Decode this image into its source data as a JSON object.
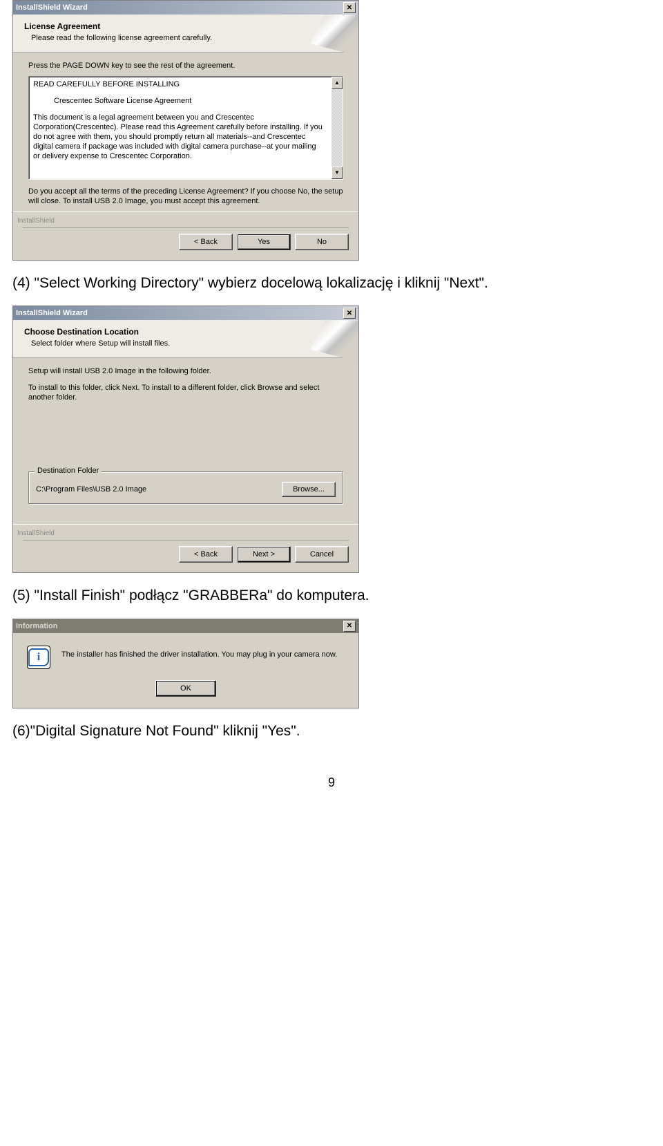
{
  "page_number": "9",
  "captions": {
    "step4": "(4) \"Select Working Directory\" wybierz docelową lokalizację i kliknij \"Next\".",
    "step5": "(5) \"Install Finish\" podłącz \"GRABBERa\" do komputera.",
    "step6": "(6)\"Digital Signature Not Found\" kliknij \"Yes\"."
  },
  "dialog1": {
    "title": "InstallShield Wizard",
    "header_title": "License Agreement",
    "header_sub": "Please read the following license agreement carefully.",
    "instruction": "Press the PAGE DOWN key to see the rest of the agreement.",
    "license_line1": "READ CAREFULLY BEFORE INSTALLING",
    "license_line2": "Crescentec Software License Agreement",
    "license_body": "This document is a legal agreement between you and Crescentec Corporation(Crescentec). Please read this Agreement carefully before installing. If you do not agree with them, you should promptly return all materials--and Crescentec digital camera if package was included with digital camera purchase--at your mailing or delivery expense to Crescentec Corporation.",
    "accept_text": "Do you accept all the terms of the preceding License Agreement?  If you choose No,  the setup will close.  To install USB 2.0 Image, you must accept this agreement.",
    "brand": "InstallShield",
    "btn_back": "< Back",
    "btn_yes": "Yes",
    "btn_no": "No"
  },
  "dialog2": {
    "title": "InstallShield Wizard",
    "header_title": "Choose Destination Location",
    "header_sub": "Select folder where Setup will install files.",
    "line1": "Setup will install USB 2.0 Image in the following folder.",
    "line2": "To install to this folder, click Next. To install to a different folder, click Browse and select another folder.",
    "group_label": "Destination Folder",
    "path": "C:\\Program Files\\USB 2.0 Image",
    "browse": "Browse...",
    "brand": "InstallShield",
    "btn_back": "< Back",
    "btn_next": "Next >",
    "btn_cancel": "Cancel"
  },
  "dialog3": {
    "title": "Information",
    "body": "The installer has finished the driver installation. You may plug in your camera now.",
    "btn_ok": "OK"
  }
}
